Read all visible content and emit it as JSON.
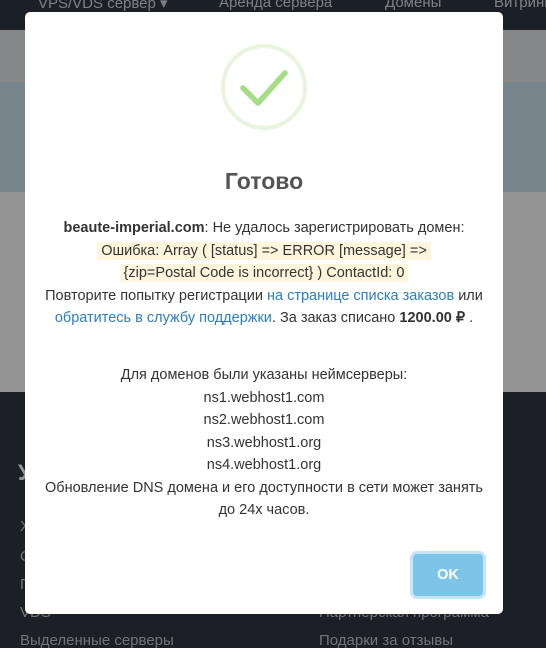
{
  "background": {
    "nav": [
      "VPS/VDS сервер ▾",
      "Аренда сервера",
      "Домены",
      "Витрины"
    ],
    "footer_heading": "У",
    "footer_left": [
      "Х",
      "С",
      "П",
      "VDS",
      "Выделенные серверы"
    ],
    "footer_right": [
      "Партнерская программа",
      "Подарки за отзывы"
    ]
  },
  "modal": {
    "title": "Готово",
    "domain": "beaute-imperial.com",
    "text_after_domain": ": Не удалось зарегистрировать домен: ",
    "error_line1": "Ошибка: Array ( [status] => ERROR [message] =>",
    "error_line2": "{zip=Postal Code is incorrect} ) ContactId: 0",
    "retry_text": "Повторите попытку регистрации ",
    "orders_link": "на странице списка заказов",
    "or_text": " или ",
    "support_link": "обратитесь в службу поддержки",
    "charged_text": ". За заказ списано ",
    "amount": "1200.00 ₽",
    "period": " .",
    "ns_intro": "Для доменов были указаны неймсерверы:",
    "nameservers": [
      "ns1.webhost1.com",
      "ns2.webhost1.com",
      "ns3.webhost1.org",
      "ns4.webhost1.org"
    ],
    "dns_note": "Обновление DNS домена и его доступности в сети может занять до 24х часов.",
    "ok_label": "OK"
  },
  "colors": {
    "success": "#a5dc86",
    "link": "#2c7ec0",
    "ok_button": "#7cc5e9",
    "error_highlight": "#fdf6dc"
  }
}
